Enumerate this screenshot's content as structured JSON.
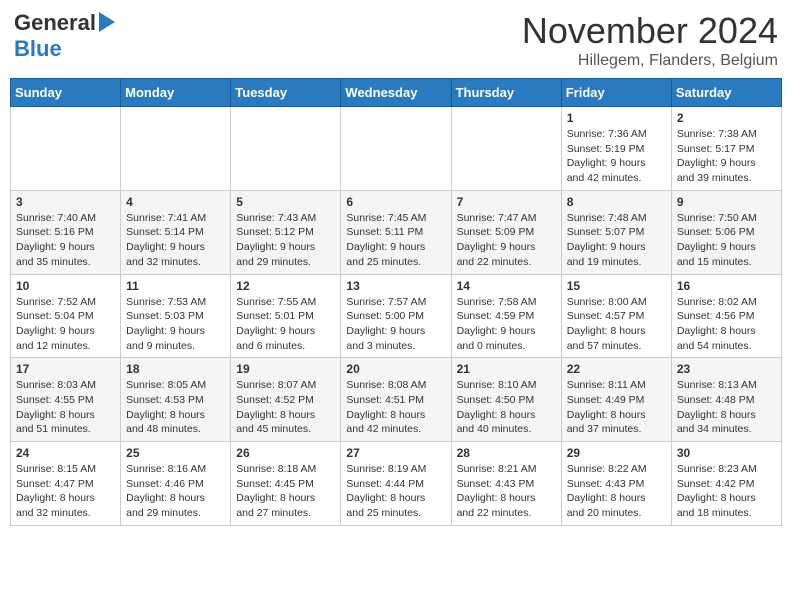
{
  "header": {
    "logo_general": "General",
    "logo_blue": "Blue",
    "month_title": "November 2024",
    "subtitle": "Hillegem, Flanders, Belgium"
  },
  "days_of_week": [
    "Sunday",
    "Monday",
    "Tuesday",
    "Wednesday",
    "Thursday",
    "Friday",
    "Saturday"
  ],
  "weeks": [
    [
      {
        "day": "",
        "info": ""
      },
      {
        "day": "",
        "info": ""
      },
      {
        "day": "",
        "info": ""
      },
      {
        "day": "",
        "info": ""
      },
      {
        "day": "",
        "info": ""
      },
      {
        "day": "1",
        "info": "Sunrise: 7:36 AM\nSunset: 5:19 PM\nDaylight: 9 hours and 42 minutes."
      },
      {
        "day": "2",
        "info": "Sunrise: 7:38 AM\nSunset: 5:17 PM\nDaylight: 9 hours and 39 minutes."
      }
    ],
    [
      {
        "day": "3",
        "info": "Sunrise: 7:40 AM\nSunset: 5:16 PM\nDaylight: 9 hours and 35 minutes."
      },
      {
        "day": "4",
        "info": "Sunrise: 7:41 AM\nSunset: 5:14 PM\nDaylight: 9 hours and 32 minutes."
      },
      {
        "day": "5",
        "info": "Sunrise: 7:43 AM\nSunset: 5:12 PM\nDaylight: 9 hours and 29 minutes."
      },
      {
        "day": "6",
        "info": "Sunrise: 7:45 AM\nSunset: 5:11 PM\nDaylight: 9 hours and 25 minutes."
      },
      {
        "day": "7",
        "info": "Sunrise: 7:47 AM\nSunset: 5:09 PM\nDaylight: 9 hours and 22 minutes."
      },
      {
        "day": "8",
        "info": "Sunrise: 7:48 AM\nSunset: 5:07 PM\nDaylight: 9 hours and 19 minutes."
      },
      {
        "day": "9",
        "info": "Sunrise: 7:50 AM\nSunset: 5:06 PM\nDaylight: 9 hours and 15 minutes."
      }
    ],
    [
      {
        "day": "10",
        "info": "Sunrise: 7:52 AM\nSunset: 5:04 PM\nDaylight: 9 hours and 12 minutes."
      },
      {
        "day": "11",
        "info": "Sunrise: 7:53 AM\nSunset: 5:03 PM\nDaylight: 9 hours and 9 minutes."
      },
      {
        "day": "12",
        "info": "Sunrise: 7:55 AM\nSunset: 5:01 PM\nDaylight: 9 hours and 6 minutes."
      },
      {
        "day": "13",
        "info": "Sunrise: 7:57 AM\nSunset: 5:00 PM\nDaylight: 9 hours and 3 minutes."
      },
      {
        "day": "14",
        "info": "Sunrise: 7:58 AM\nSunset: 4:59 PM\nDaylight: 9 hours and 0 minutes."
      },
      {
        "day": "15",
        "info": "Sunrise: 8:00 AM\nSunset: 4:57 PM\nDaylight: 8 hours and 57 minutes."
      },
      {
        "day": "16",
        "info": "Sunrise: 8:02 AM\nSunset: 4:56 PM\nDaylight: 8 hours and 54 minutes."
      }
    ],
    [
      {
        "day": "17",
        "info": "Sunrise: 8:03 AM\nSunset: 4:55 PM\nDaylight: 8 hours and 51 minutes."
      },
      {
        "day": "18",
        "info": "Sunrise: 8:05 AM\nSunset: 4:53 PM\nDaylight: 8 hours and 48 minutes."
      },
      {
        "day": "19",
        "info": "Sunrise: 8:07 AM\nSunset: 4:52 PM\nDaylight: 8 hours and 45 minutes."
      },
      {
        "day": "20",
        "info": "Sunrise: 8:08 AM\nSunset: 4:51 PM\nDaylight: 8 hours and 42 minutes."
      },
      {
        "day": "21",
        "info": "Sunrise: 8:10 AM\nSunset: 4:50 PM\nDaylight: 8 hours and 40 minutes."
      },
      {
        "day": "22",
        "info": "Sunrise: 8:11 AM\nSunset: 4:49 PM\nDaylight: 8 hours and 37 minutes."
      },
      {
        "day": "23",
        "info": "Sunrise: 8:13 AM\nSunset: 4:48 PM\nDaylight: 8 hours and 34 minutes."
      }
    ],
    [
      {
        "day": "24",
        "info": "Sunrise: 8:15 AM\nSunset: 4:47 PM\nDaylight: 8 hours and 32 minutes."
      },
      {
        "day": "25",
        "info": "Sunrise: 8:16 AM\nSunset: 4:46 PM\nDaylight: 8 hours and 29 minutes."
      },
      {
        "day": "26",
        "info": "Sunrise: 8:18 AM\nSunset: 4:45 PM\nDaylight: 8 hours and 27 minutes."
      },
      {
        "day": "27",
        "info": "Sunrise: 8:19 AM\nSunset: 4:44 PM\nDaylight: 8 hours and 25 minutes."
      },
      {
        "day": "28",
        "info": "Sunrise: 8:21 AM\nSunset: 4:43 PM\nDaylight: 8 hours and 22 minutes."
      },
      {
        "day": "29",
        "info": "Sunrise: 8:22 AM\nSunset: 4:43 PM\nDaylight: 8 hours and 20 minutes."
      },
      {
        "day": "30",
        "info": "Sunrise: 8:23 AM\nSunset: 4:42 PM\nDaylight: 8 hours and 18 minutes."
      }
    ]
  ]
}
